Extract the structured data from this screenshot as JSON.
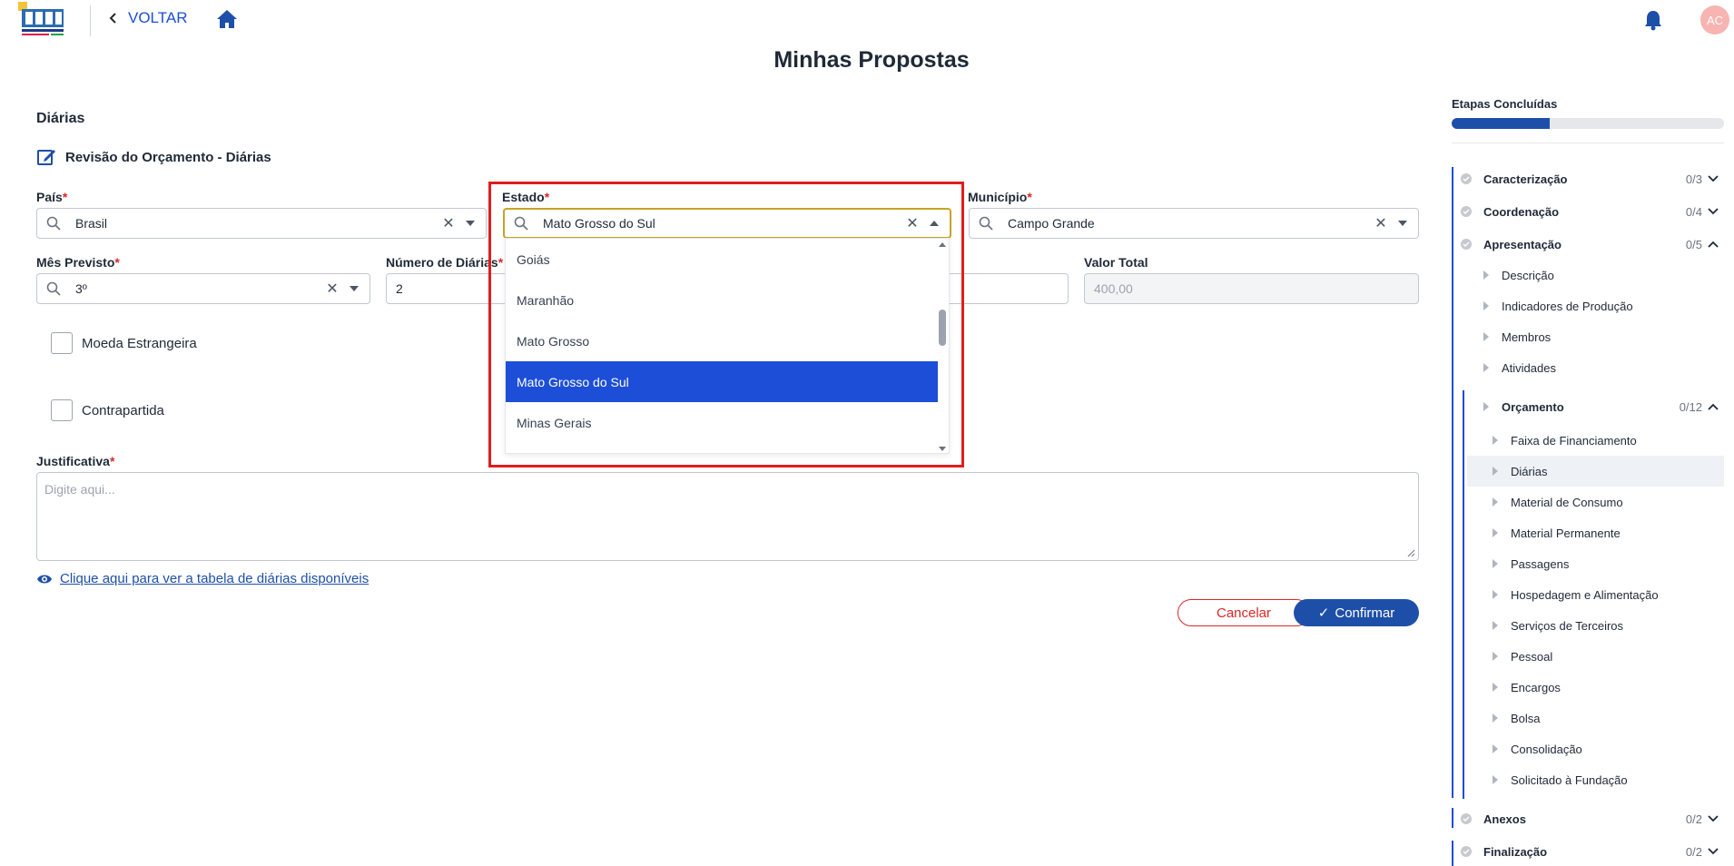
{
  "header": {
    "back_label": "VOLTAR",
    "avatar_initials": "AC"
  },
  "page_title": "Minhas Propostas",
  "section": {
    "title": "Diárias",
    "review_label": "Revisão do Orçamento - Diárias"
  },
  "form": {
    "pais": {
      "label": "País",
      "value": "Brasil"
    },
    "estado": {
      "label": "Estado",
      "value": "Mato Grosso do Sul"
    },
    "municipio": {
      "label": "Município",
      "value": "Campo Grande"
    },
    "mes_previsto": {
      "label": "Mês Previsto",
      "value": "3º"
    },
    "numero_diarias": {
      "label": "Número de Diárias",
      "value": "2"
    },
    "valor_total": {
      "label": "Valor Total",
      "value": "400,00"
    },
    "moeda_estrangeira_label": "Moeda Estrangeira",
    "contrapartida_label": "Contrapartida",
    "justificativa": {
      "label": "Justificativa",
      "placeholder": "Digite aqui..."
    },
    "link_label": "Clique aqui para ver a tabela de diárias disponíveis",
    "cancel_label": "Cancelar",
    "confirm_label": "Confirmar"
  },
  "dropdown": {
    "options": [
      "Goiás",
      "Maranhão",
      "Mato Grosso",
      "Mato Grosso do Sul",
      "Minas Gerais"
    ],
    "selected": "Mato Grosso do Sul"
  },
  "progress": {
    "label": "Etapas Concluídas",
    "fraction": 0.36,
    "accent": "#1e4fa8"
  },
  "steps": [
    {
      "label": "Caracterização",
      "count": "0/3",
      "expanded": false
    },
    {
      "label": "Coordenação",
      "count": "0/4",
      "expanded": false
    },
    {
      "label": "Apresentação",
      "count": "0/5",
      "expanded": true
    },
    {
      "label": "Anexos",
      "count": "0/2",
      "expanded": false
    },
    {
      "label": "Finalização",
      "count": "0/2",
      "expanded": false
    }
  ],
  "apresentacao_items": [
    "Descrição",
    "Indicadores de Produção",
    "Membros",
    "Atividades"
  ],
  "orcamento": {
    "label": "Orçamento",
    "count": "0/12",
    "items": [
      "Faixa de Financiamento",
      "Diárias",
      "Material de Consumo",
      "Material Permanente",
      "Passagens",
      "Hospedagem e Alimentação",
      "Serviços de Terceiros",
      "Pessoal",
      "Encargos",
      "Bolsa",
      "Consolidação",
      "Solicitado à Fundação"
    ],
    "active": "Diárias"
  },
  "colors": {
    "primary": "#1e4fa8",
    "selected_option": "#1d4ed8",
    "required": "#dc2626",
    "highlight_border": "#e11d1d"
  }
}
